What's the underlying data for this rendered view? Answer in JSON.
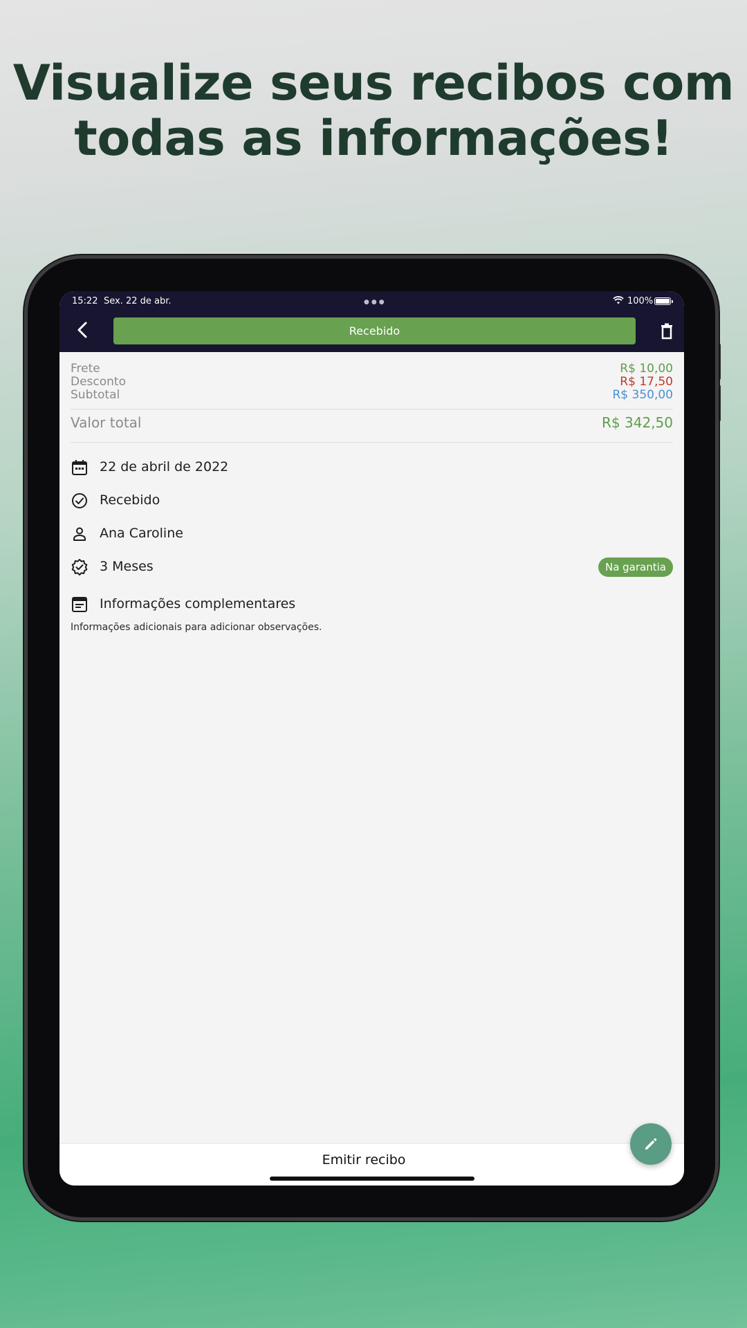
{
  "headline": {
    "line1": "Visualize seus recibos com",
    "line2": "todas as informações!"
  },
  "status_bar": {
    "time": "15:22",
    "date": "Sex. 22 de abr.",
    "battery": "100%"
  },
  "header": {
    "back_icon": "chevron-left-icon",
    "status_label": "Recebido",
    "trash_icon": "trash-icon",
    "status_color": "#68a150"
  },
  "summary": {
    "frete": {
      "label": "Frete",
      "value": "R$ 10,00",
      "color": "#5f9e49"
    },
    "desconto": {
      "label": "Desconto",
      "value": "R$ 17,50",
      "color": "#c0392b"
    },
    "subtotal": {
      "label": "Subtotal",
      "value": "R$ 350,00",
      "color": "#4a8fd6"
    },
    "total": {
      "label": "Valor total",
      "value": "R$ 342,50",
      "color": "#5f9e49"
    }
  },
  "details": {
    "date": {
      "icon": "calendar-icon",
      "text": "22 de abril de 2022"
    },
    "status": {
      "icon": "check-circle-icon",
      "text": "Recebido"
    },
    "client": {
      "icon": "person-icon",
      "text": "Ana Caroline"
    },
    "warranty": {
      "icon": "verified-badge-icon",
      "text": "3 Meses",
      "badge": "Na garantia"
    },
    "notes": {
      "icon": "notes-icon",
      "title": "Informações complementares",
      "text": "Informações adicionais para adicionar observações."
    }
  },
  "fab": {
    "icon": "pencil-icon"
  },
  "bottom": {
    "emit_label": "Emitir recibo"
  }
}
